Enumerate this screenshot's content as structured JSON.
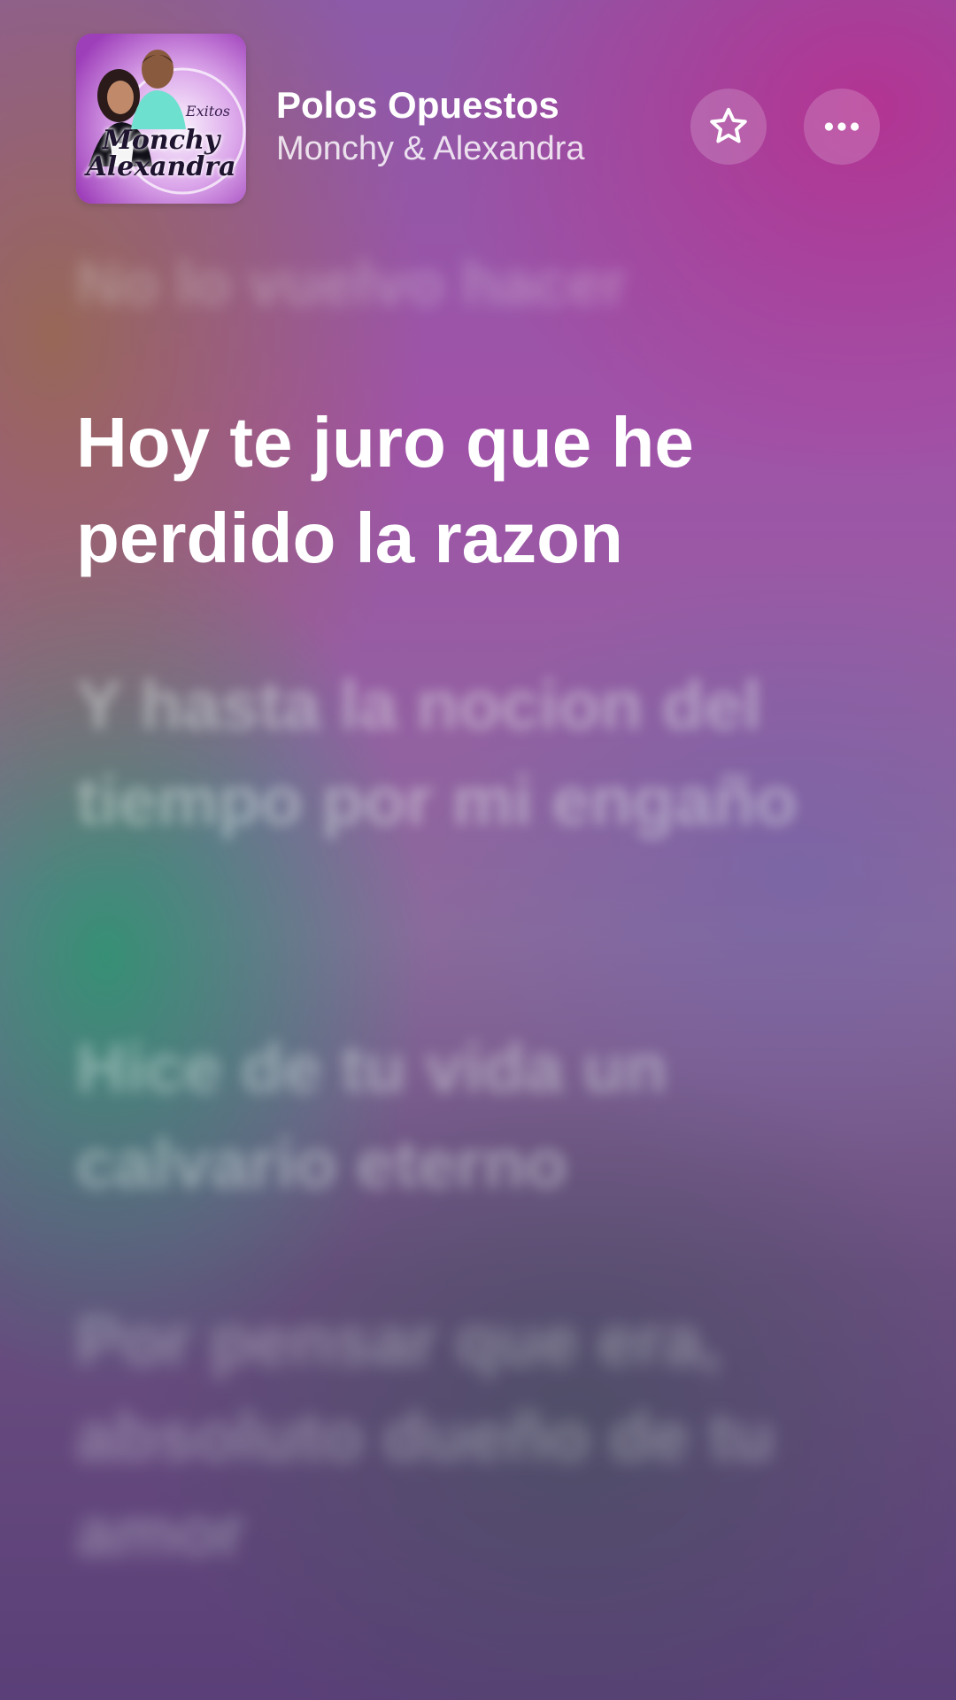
{
  "now_playing": {
    "title": "Polos Opuestos",
    "artist": "Monchy & Alexandra",
    "artwork": {
      "text_line1": "Monchy",
      "text_line2": "Alexandra",
      "badge": "Exitos"
    }
  },
  "actions": {
    "favorite_icon": "star-icon",
    "more_icon": "ellipsis-icon"
  },
  "lyrics": [
    {
      "text": "No lo vuelvo hacer",
      "state": "past"
    },
    {
      "text": "Hoy te juro que he perdido la razon",
      "state": "current"
    },
    {
      "text": "Y hasta la nocion del tiempo por mi engaño",
      "state": "upcoming"
    },
    {
      "text": "Hice de tu vida un calvario eterno",
      "state": "upcoming"
    },
    {
      "text": "Por pensar que era, absoluto dueño de tu amor",
      "state": "upcoming"
    }
  ],
  "colors": {
    "current_lyric": "#ffffff",
    "inactive_lyric": "rgba(235,245,240,0.42)",
    "button_bg": "rgba(255,255,255,0.18)"
  }
}
